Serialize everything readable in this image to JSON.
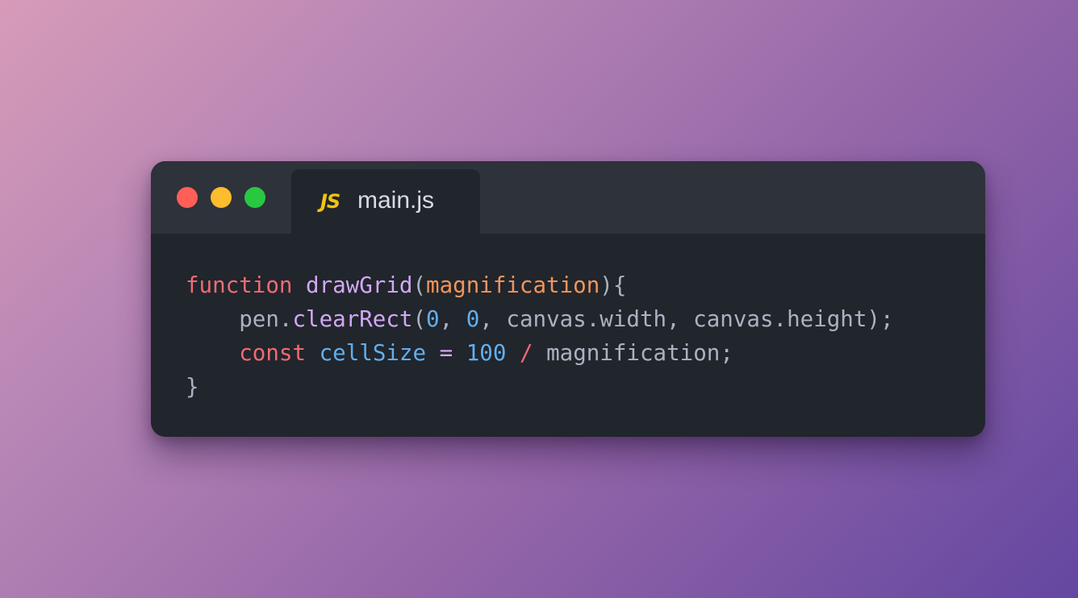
{
  "colors": {
    "background_gradient": [
      "#d79bb8",
      "#b685b5",
      "#9466a8",
      "#6447a1"
    ],
    "window_bg": "#21252c",
    "titlebar_bg": "#2e323a",
    "close": "#ff5f57",
    "minimize": "#febc2e",
    "maximize": "#28c840",
    "tab_text": "#d8dce2",
    "js_icon": "#f1c40f"
  },
  "window": {
    "controls": [
      {
        "name": "close-button",
        "color": "#ff5f57"
      },
      {
        "name": "minimize-button",
        "color": "#febc2e"
      },
      {
        "name": "maximize-button",
        "color": "#28c840"
      }
    ]
  },
  "tab": {
    "icon": "javascript-file-icon",
    "icon_text": "JS",
    "label": "main.js"
  },
  "code": {
    "lines": [
      [
        {
          "text": "function",
          "color": "#ef6b73"
        },
        {
          "text": " ",
          "color": "#abb2bf"
        },
        {
          "text": "drawGrid",
          "color": "#d2a8f5"
        },
        {
          "text": "(",
          "color": "#abb2bf"
        },
        {
          "text": "magnification",
          "color": "#f0955a"
        },
        {
          "text": "){",
          "color": "#abb2bf"
        }
      ],
      [
        {
          "text": "    pen.",
          "color": "#abb2bf"
        },
        {
          "text": "clearRect",
          "color": "#d2a8f5"
        },
        {
          "text": "(",
          "color": "#abb2bf"
        },
        {
          "text": "0",
          "color": "#61afef"
        },
        {
          "text": ", ",
          "color": "#abb2bf"
        },
        {
          "text": "0",
          "color": "#61afef"
        },
        {
          "text": ", canvas.width, canvas.height);",
          "color": "#abb2bf"
        }
      ],
      [
        {
          "text": "    ",
          "color": "#abb2bf"
        },
        {
          "text": "const",
          "color": "#ef6b73"
        },
        {
          "text": " ",
          "color": "#abb2bf"
        },
        {
          "text": "cellSize",
          "color": "#61afef"
        },
        {
          "text": " ",
          "color": "#abb2bf"
        },
        {
          "text": "=",
          "color": "#d2a8f5"
        },
        {
          "text": " ",
          "color": "#abb2bf"
        },
        {
          "text": "100",
          "color": "#61afef"
        },
        {
          "text": " ",
          "color": "#abb2bf"
        },
        {
          "text": "/",
          "color": "#ef6b73"
        },
        {
          "text": " magnification;",
          "color": "#abb2bf"
        }
      ],
      [
        {
          "text": "}",
          "color": "#abb2bf"
        }
      ]
    ]
  }
}
